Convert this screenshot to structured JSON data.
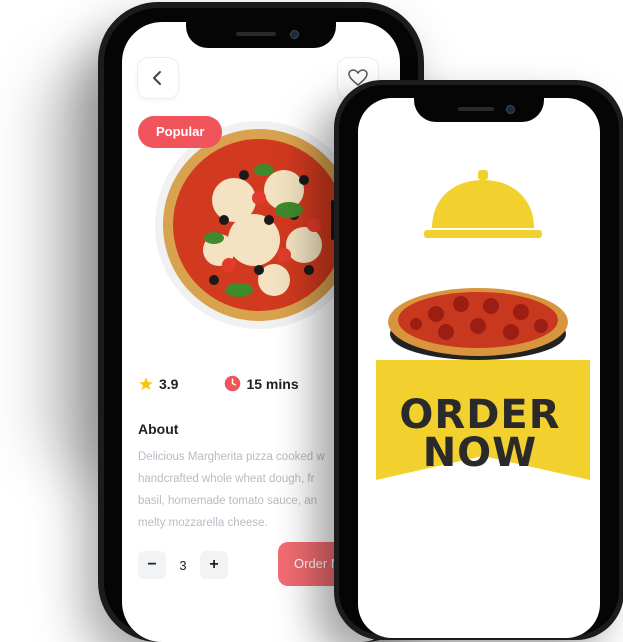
{
  "detail_screen": {
    "badge": "Popular",
    "rating": "3.9",
    "time": "15 mins",
    "about_heading": "About",
    "about_lines": [
      "Delicious Margherita pizza cooked w",
      "handcrafted whole wheat dough, fr",
      "basil, homemade tomato sauce, an",
      "melty mozzarella cheese."
    ],
    "quantity": "3",
    "minus": "−",
    "plus": "+",
    "order_button": "Order N"
  },
  "promo_screen": {
    "line1": "ORDER",
    "line2": "NOW"
  },
  "colors": {
    "accent": "#f2545b",
    "promo_yellow": "#f2d02e",
    "star": "#f5c518"
  },
  "icons": [
    "chevron-left-icon",
    "heart-icon",
    "star-icon",
    "clock-icon",
    "cloche-icon"
  ]
}
